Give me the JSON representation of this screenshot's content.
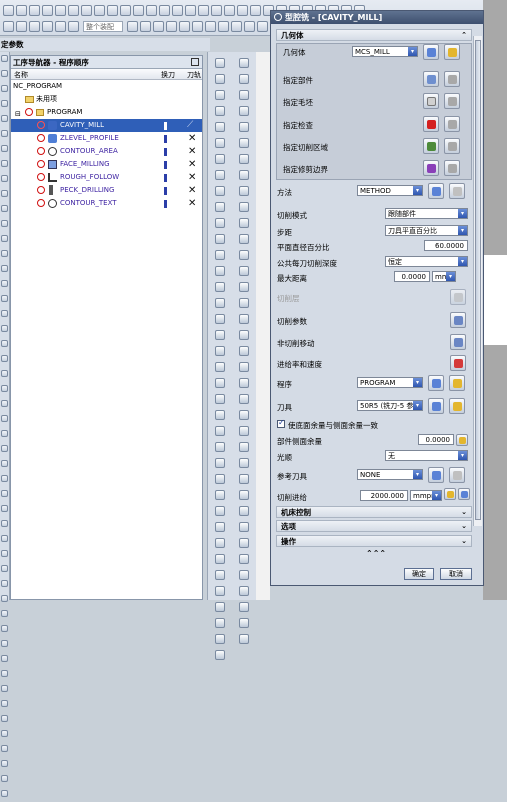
{
  "toolbar": {
    "select_placeholder": "整个装配",
    "row2_hint": ""
  },
  "settings_title": "定参数",
  "navigator": {
    "title": "工序导航器 - 程序顺序",
    "columns": {
      "name": "名称",
      "tool_change": "换刀",
      "tool_path": "刀轨"
    },
    "rows": [
      {
        "label": "NC_PROGRAM",
        "indent": 0,
        "kind": "root"
      },
      {
        "label": "未用项",
        "indent": 1,
        "kind": "folder"
      },
      {
        "label": "PROGRAM",
        "indent": 1,
        "kind": "program"
      },
      {
        "label": "CAVITY_MILL",
        "indent": 2,
        "kind": "op",
        "selected": true
      },
      {
        "label": "ZLEVEL_PROFILE",
        "indent": 2,
        "kind": "op"
      },
      {
        "label": "CONTOUR_AREA",
        "indent": 2,
        "kind": "op"
      },
      {
        "label": "FACE_MILLING",
        "indent": 2,
        "kind": "op"
      },
      {
        "label": "ROUGH_FOLLOW",
        "indent": 2,
        "kind": "op"
      },
      {
        "label": "PECK_DRILLING",
        "indent": 2,
        "kind": "op"
      },
      {
        "label": "CONTOUR_TEXT",
        "indent": 2,
        "kind": "op"
      }
    ]
  },
  "dialog": {
    "title": "型腔铣 - [CAVITY_MILL]",
    "geometry_section": "几何体",
    "geometry_label": "几何体",
    "geometry_value": "MCS_MILL",
    "geo_items": [
      "指定部件",
      "指定毛坯",
      "指定检查",
      "指定切削区域",
      "指定修剪边界"
    ],
    "method_label": "方法",
    "method_value": "METHOD",
    "cut_pattern_label": "切削模式",
    "cut_pattern_value": "跟随部件",
    "stepover_label": "步距",
    "stepover_value": "刀具平直百分比",
    "flat_pct_label": "平面直径百分比",
    "flat_pct_value": "60.0000",
    "depth_label": "公共每刀切削深度",
    "depth_value": "恒定",
    "max_dist_label": "最大距离",
    "max_dist_value": "0.0000",
    "max_dist_unit": "mm",
    "cut_layers_label": "切削层",
    "cut_params_label": "切削参数",
    "non_cut_label": "非切削移动",
    "feeds_label": "进给率和速度",
    "program_label": "程序",
    "program_value": "PROGRAM",
    "tool_label": "刀具",
    "tool_value": "50R5 (铣刀-5 参",
    "stock_checkbox_label": "使底面余量与侧面余量一致",
    "side_stock_label": "部件侧面余量",
    "side_stock_value": "0.0000",
    "smooth_label": "光顺",
    "smooth_value": "无",
    "ref_tool_label": "参考刀具",
    "ref_tool_value": "NONE",
    "feed_label": "切削进给",
    "feed_value": "2000.000",
    "feed_unit": "mmpm",
    "machine_control": "机床控制",
    "options": "选项",
    "actions": "操作",
    "ok": "确定",
    "cancel": "取消"
  }
}
